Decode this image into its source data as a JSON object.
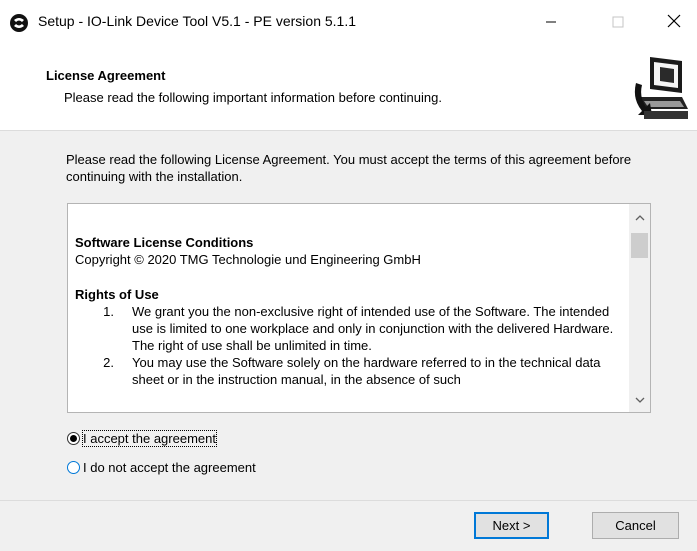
{
  "window": {
    "title": "Setup - IO-Link Device Tool V5.1 - PE version 5.1.1",
    "minimize": "—",
    "maximize": "☐",
    "close": "✕"
  },
  "header": {
    "title": "License Agreement",
    "subtitle": "Please read the following important information before continuing.",
    "logo_icon": "computer-setup-icon"
  },
  "intro_text": "Please read the following License Agreement. You must accept the terms of this agreement before continuing with the installation.",
  "license": {
    "heading": "Software License Conditions",
    "copyright": "Copyright © 2020 TMG Technologie und Engineering GmbH",
    "section_title": "Rights of Use",
    "items": [
      {
        "num": "1.",
        "text": "We grant you the non-exclusive right of intended use of the Software. The intended use is limited to one workplace and only in conjunction with the delivered Hardware. The right of use shall be unlimited in time."
      },
      {
        "num": "2.",
        "text": "You may use the Software solely on the hardware referred to in the technical data sheet or in the instruction manual, in the absence of such"
      }
    ]
  },
  "radios": {
    "accept": {
      "label": "I accept the agreement",
      "checked": true
    },
    "decline": {
      "label": "I do not accept the agreement",
      "checked": false
    }
  },
  "buttons": {
    "next": "Next >",
    "cancel": "Cancel"
  }
}
